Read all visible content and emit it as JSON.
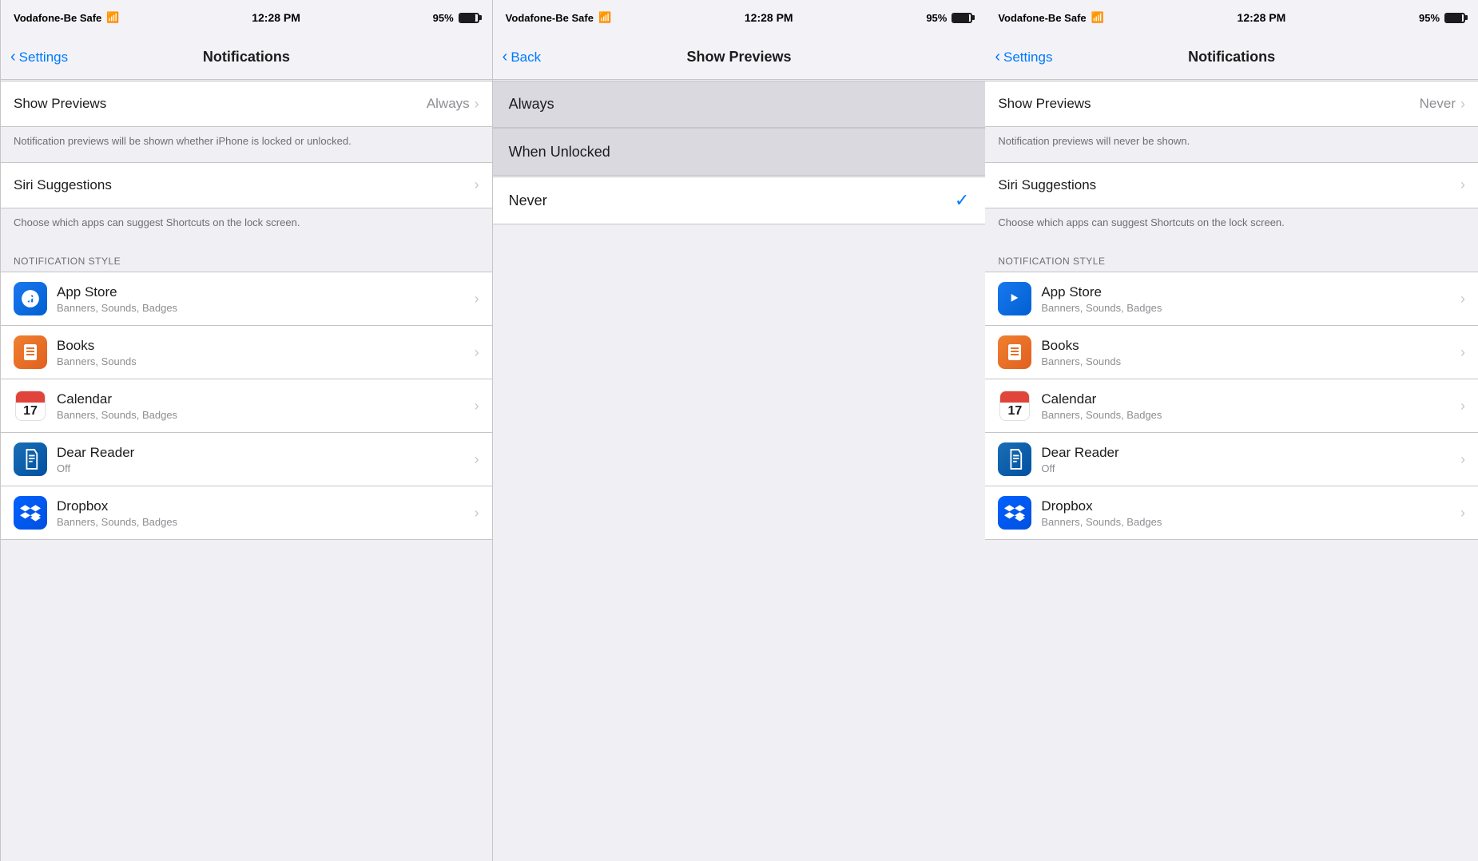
{
  "colors": {
    "blue": "#007aff",
    "gray": "#8e8e93",
    "separator": "#c6c6c8",
    "bg": "#efeff4",
    "white": "#ffffff",
    "darkBg": "#d9d9df",
    "text": "#1c1c1e",
    "textSecondary": "#6d6d72"
  },
  "panels": [
    {
      "id": "left",
      "statusBar": {
        "carrier": "Vodafone-Be Safe",
        "time": "12:28 PM",
        "battery": "95%"
      },
      "navBar": {
        "backLabel": "Settings",
        "title": "Notifications"
      },
      "showPreviewsRow": {
        "label": "Show Previews",
        "value": "Always"
      },
      "showPreviewsFooter": "Notification previews will be shown whether iPhone is locked or unlocked.",
      "siriSuggestionsRow": {
        "label": "Siri Suggestions"
      },
      "siriSuggestionsFooter": "Choose which apps can suggest Shortcuts on the lock screen.",
      "notificationStyleLabel": "NOTIFICATION STYLE",
      "apps": [
        {
          "name": "App Store",
          "detail": "Banners, Sounds, Badges",
          "iconClass": "icon-appstore",
          "emoji": "🅰"
        },
        {
          "name": "Books",
          "detail": "Banners, Sounds",
          "iconClass": "icon-books",
          "emoji": "📖"
        },
        {
          "name": "Calendar",
          "detail": "Banners, Sounds, Badges",
          "iconClass": "icon-calendar",
          "emoji": "📅"
        },
        {
          "name": "Dear Reader",
          "detail": "Off",
          "iconClass": "icon-dearreader",
          "emoji": "🔖"
        },
        {
          "name": "Dropbox",
          "detail": "Banners, Sounds, Badges",
          "iconClass": "icon-dropbox",
          "emoji": "📦"
        }
      ]
    },
    {
      "id": "middle",
      "statusBar": {
        "carrier": "Vodafone-Be Safe",
        "time": "12:28 PM",
        "battery": "95%"
      },
      "navBar": {
        "backLabel": "Back",
        "title": "Show Previews"
      },
      "options": [
        {
          "label": "Always",
          "selected": false,
          "darkBg": true
        },
        {
          "label": "When Unlocked",
          "selected": false,
          "darkBg": true
        },
        {
          "label": "Never",
          "selected": true,
          "darkBg": false
        }
      ]
    },
    {
      "id": "right",
      "statusBar": {
        "carrier": "Vodafone-Be Safe",
        "time": "12:28 PM",
        "battery": "95%"
      },
      "navBar": {
        "backLabel": "Settings",
        "title": "Notifications"
      },
      "showPreviewsRow": {
        "label": "Show Previews",
        "value": "Never"
      },
      "showPreviewsFooter": "Notification previews will never be shown.",
      "siriSuggestionsRow": {
        "label": "Siri Suggestions"
      },
      "siriSuggestionsFooter": "Choose which apps can suggest Shortcuts on the lock screen.",
      "notificationStyleLabel": "NOTIFICATION STYLE",
      "apps": [
        {
          "name": "App Store",
          "detail": "Banners, Sounds, Badges",
          "iconClass": "icon-appstore"
        },
        {
          "name": "Books",
          "detail": "Banners, Sounds",
          "iconClass": "icon-books"
        },
        {
          "name": "Calendar",
          "detail": "Banners, Sounds, Badges",
          "iconClass": "icon-calendar"
        },
        {
          "name": "Dear Reader",
          "detail": "Off",
          "iconClass": "icon-dearreader"
        },
        {
          "name": "Dropbox",
          "detail": "Banners, Sounds, Badges",
          "iconClass": "icon-dropbox"
        }
      ]
    }
  ]
}
